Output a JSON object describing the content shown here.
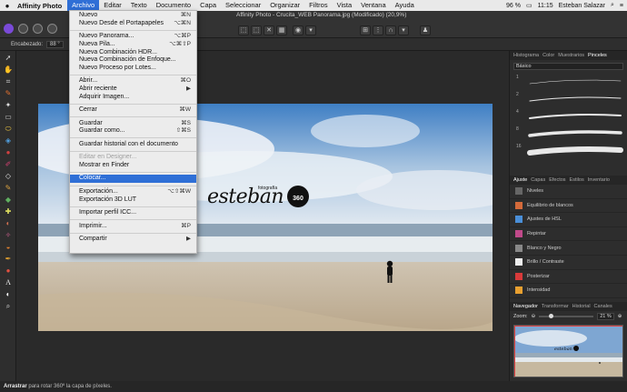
{
  "menubar": {
    "app": "Affinity Photo",
    "items": [
      "Archivo",
      "Editar",
      "Texto",
      "Documento",
      "Capa",
      "Seleccionar",
      "Organizar",
      "Filtros",
      "Vista",
      "Ventana",
      "Ayuda"
    ],
    "battery": "96 %",
    "time": "11:15",
    "user": "Esteban Salazar"
  },
  "window": {
    "title": "Affinity Photo - Crucita_WEB Panorama.jpg (Modificado) (20,9%)"
  },
  "contextbar": {
    "label": "Encabezado:",
    "value": "88 °"
  },
  "file_menu": {
    "sections": [
      [
        {
          "label": "Nuevo",
          "shortcut": "⌘N"
        },
        {
          "label": "Nuevo Desde el Portapapeles",
          "shortcut": "⌥⌘N"
        }
      ],
      [
        {
          "label": "Nuevo Panorama...",
          "shortcut": "⌥⌘P"
        },
        {
          "label": "Nueva Pila...",
          "shortcut": "⌥⌘⇧P"
        },
        {
          "label": "Nueva Combinación HDR...",
          "shortcut": ""
        },
        {
          "label": "Nueva Combinación de Enfoque...",
          "shortcut": ""
        },
        {
          "label": "Nuevo Proceso por Lotes...",
          "shortcut": ""
        }
      ],
      [
        {
          "label": "Abrir...",
          "shortcut": "⌘O"
        },
        {
          "label": "Abrir reciente",
          "shortcut": "▶"
        },
        {
          "label": "Adquirir Imagen...",
          "shortcut": ""
        }
      ],
      [
        {
          "label": "Cerrar",
          "shortcut": "⌘W"
        }
      ],
      [
        {
          "label": "Guardar",
          "shortcut": "⌘S"
        },
        {
          "label": "Guardar como...",
          "shortcut": "⇧⌘S"
        }
      ],
      [
        {
          "label": "Guardar historial con el documento",
          "shortcut": ""
        }
      ],
      [
        {
          "label": "Editar en Designer...",
          "shortcut": "",
          "disabled": true
        },
        {
          "label": "Mostrar en Finder",
          "shortcut": ""
        }
      ],
      [
        {
          "label": "Colocar...",
          "shortcut": "",
          "highlighted": true
        }
      ],
      [
        {
          "label": "Exportación...",
          "shortcut": "⌥⇧⌘W"
        },
        {
          "label": "Exportación 3D LUT",
          "shortcut": ""
        }
      ],
      [
        {
          "label": "Importar perfil ICC...",
          "shortcut": ""
        }
      ],
      [
        {
          "label": "Imprimir...",
          "shortcut": "⌘P"
        }
      ],
      [
        {
          "label": "Compartir",
          "shortcut": "▶"
        }
      ]
    ]
  },
  "photo": {
    "logo_text": "esteban",
    "logo_small": "fotografía",
    "logo_badge": "360"
  },
  "brushes_panel": {
    "tabs": [
      "Histograma",
      "Color",
      "Muestrarios",
      "Pinceles"
    ],
    "category": "Básico",
    "sizes": [
      "1",
      "2",
      "4",
      "8",
      "16"
    ]
  },
  "adjust_panel": {
    "tabs": [
      "Ajuste",
      "Capas",
      "Efectos",
      "Estilos",
      "Inventario"
    ],
    "items": [
      {
        "label": "Niveles",
        "color": "#666666"
      },
      {
        "label": "Equilibrio de blancos",
        "color": "#d46a3a"
      },
      {
        "label": "Ajustes de HSL",
        "color": "#4a8fd8"
      },
      {
        "label": "Repintar",
        "color": "#c04a8a"
      },
      {
        "label": "Blanco y Negro",
        "color": "#888888"
      },
      {
        "label": "Brillo / Contraste",
        "color": "#eeeeee"
      },
      {
        "label": "Posterizar",
        "color": "#d83a3a"
      },
      {
        "label": "Intensidad",
        "color": "#e8a030"
      }
    ]
  },
  "navigator_panel": {
    "tabs": [
      "Navegador",
      "Transformar",
      "Historial",
      "Canales"
    ],
    "zoom_label": "Zoom:",
    "zoom_value": "21 %",
    "zoom_level": 0.21
  },
  "statusbar": {
    "action": "Arrastrar",
    "hint": "para rotar 360º la capa de píxeles."
  }
}
